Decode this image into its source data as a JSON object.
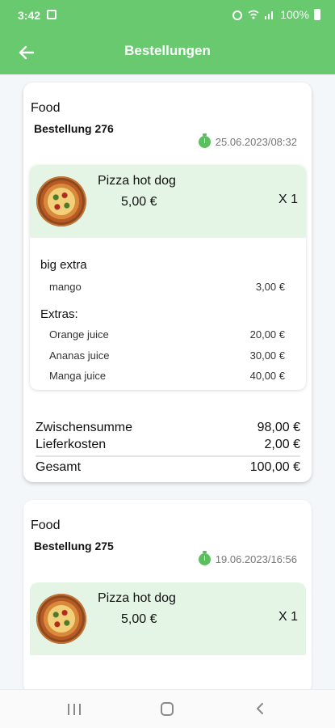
{
  "status_bar": {
    "time": "3:42",
    "battery": "100%"
  },
  "app_bar": {
    "title": "Bestellungen"
  },
  "orders": [
    {
      "category": "Food",
      "order_label": "Bestellung  276",
      "date": "25.06.2023/08:32",
      "item": {
        "name": "Pizza hot dog",
        "price": "5,00 €",
        "quantity": "X 1"
      },
      "options": [
        {
          "heading": "big extra",
          "rows": [
            {
              "name": "mango",
              "price": "3,00 €"
            }
          ]
        },
        {
          "heading": "Extras:",
          "rows": [
            {
              "name": "Orange juice",
              "price": "20,00 €"
            },
            {
              "name": "Ananas juice",
              "price": "30,00 €"
            },
            {
              "name": "Manga juice",
              "price": "40,00 €"
            }
          ]
        }
      ],
      "totals": [
        {
          "label": "Zwischensumme",
          "value": "98,00 €"
        },
        {
          "label": "Lieferkosten",
          "value": "2,00 €"
        },
        {
          "label": "Gesamt",
          "value": "100,00 €"
        }
      ]
    },
    {
      "category": "Food",
      "order_label": "Bestellung  275",
      "date": "19.06.2023/16:56",
      "item": {
        "name": "Pizza hot dog",
        "price": "5,00 €",
        "quantity": "X 1"
      }
    }
  ],
  "icons": {
    "back": "arrow-left-icon",
    "clock": "timer-icon",
    "nav_recent": "recent-apps-icon",
    "nav_home": "home-icon",
    "nav_back": "chevron-left-icon"
  },
  "colors": {
    "primary": "#68c96f",
    "item_header_bg": "#e5f5e5",
    "clock": "#5cbf5f"
  }
}
